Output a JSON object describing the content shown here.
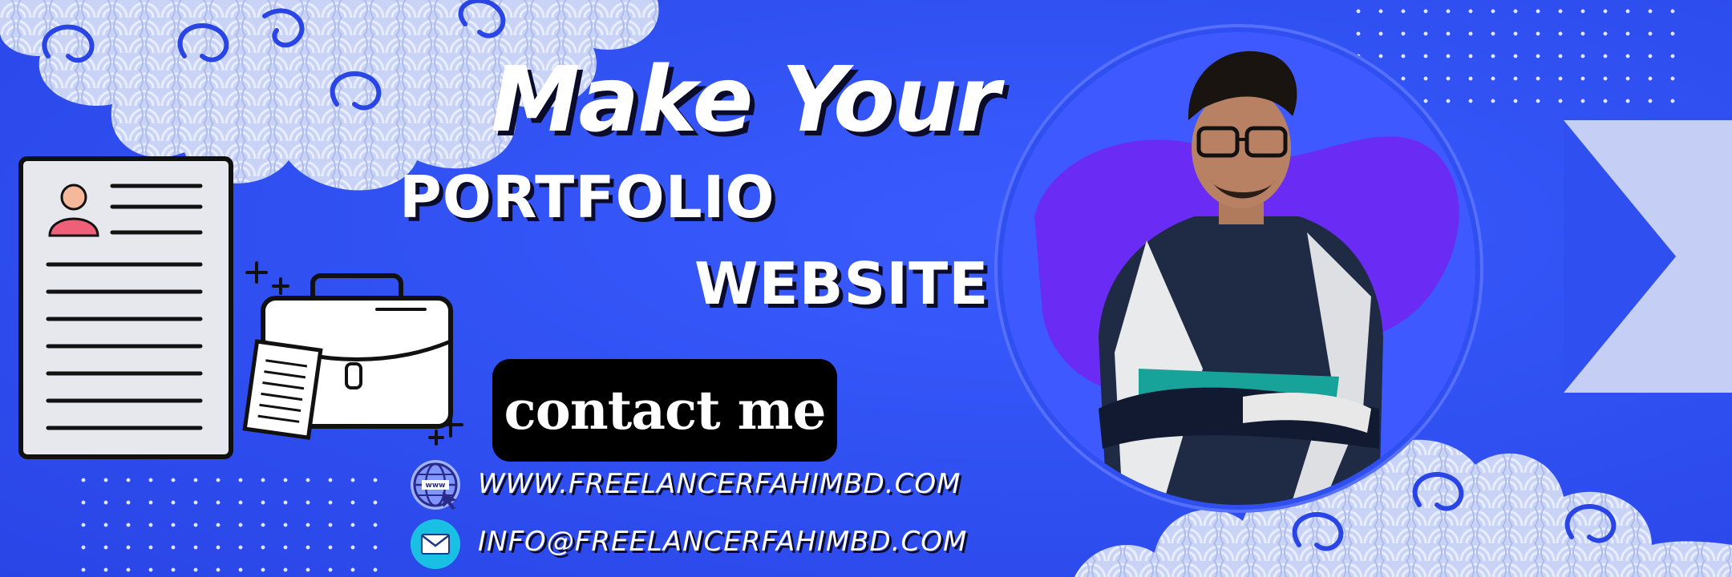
{
  "headline": {
    "line1": "Make Your",
    "line2": "PORTFOLIO",
    "line3": "WEBSITE"
  },
  "cta": {
    "label": "contact me"
  },
  "contact": {
    "website": "WWW.FREELANCERFAHIMBD.COM",
    "email": "INFO@FREELANCERFAHIMBD.COM"
  },
  "icons": {
    "resume": "resume-document-icon",
    "briefcase": "briefcase-icon",
    "globe": "globe-cursor-icon",
    "mail": "envelope-icon"
  },
  "colors": {
    "background": "#2f4ff0",
    "cloud": "#c9d3f5",
    "photo_ring": "#3d59ff",
    "photo_blob": "#6a2cf5",
    "cta_bg": "#000000",
    "text": "#ffffff"
  }
}
